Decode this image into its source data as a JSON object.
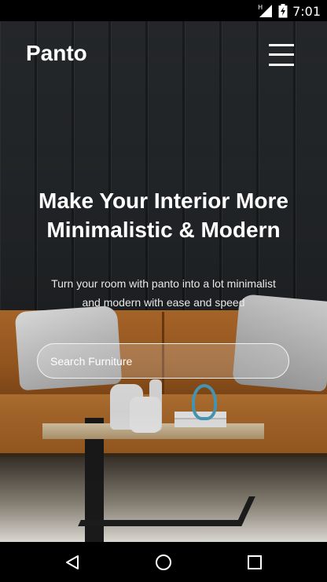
{
  "status_bar": {
    "network_label": "H",
    "time": "7:01",
    "icons": [
      "network-type-icon",
      "signal-icon",
      "battery-charging-icon"
    ]
  },
  "header": {
    "brand": "Panto",
    "menu_icon": "hamburger-menu-icon"
  },
  "hero": {
    "headline_line1": "Make Your Interior More",
    "headline_line2": "Minimalistic & Modern",
    "subtext_line1": "Turn your room with panto into a lot minimalist",
    "subtext_line2": "and modern with ease and speed",
    "image": "living-room-sofa-photo"
  },
  "search": {
    "placeholder": "Search Furniture",
    "value": ""
  },
  "nav_bar": {
    "buttons": [
      "back-icon",
      "home-icon",
      "recents-icon"
    ]
  },
  "colors": {
    "status_bar": "#000000",
    "text": "#ffffff",
    "sofa": "#a8621f",
    "accent_deco": "#4da6c6"
  }
}
